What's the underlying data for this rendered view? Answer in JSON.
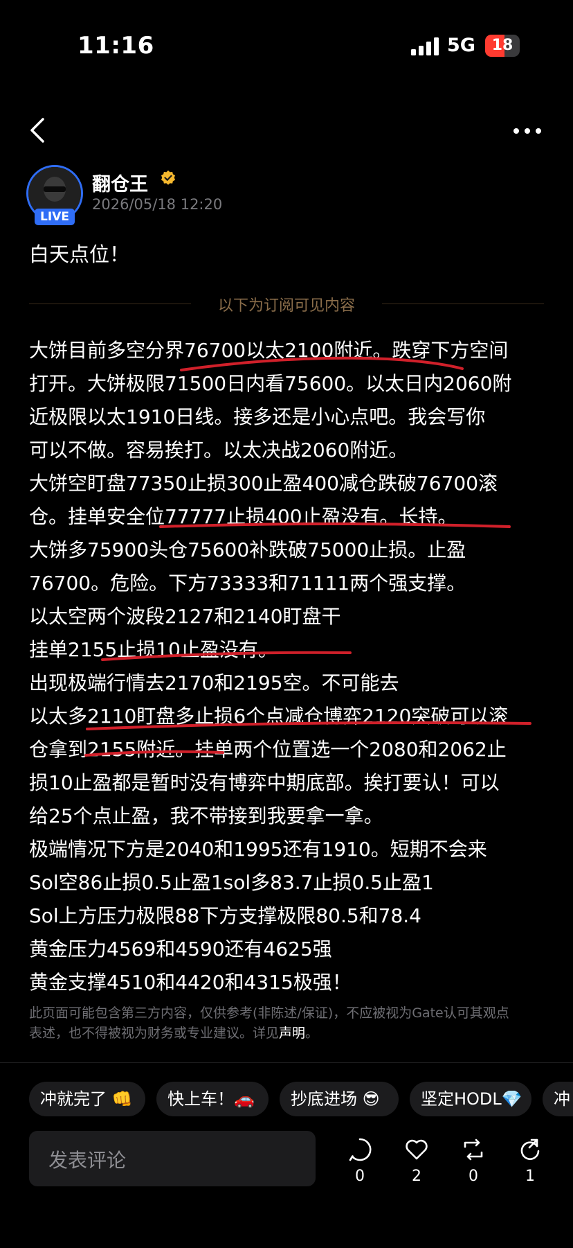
{
  "status_bar": {
    "time": "11:16",
    "network": "5G",
    "battery": "18"
  },
  "nav": {
    "back_icon": "chevron-left-icon",
    "more_icon": "more-dots-icon"
  },
  "post": {
    "author": "翻仓王",
    "live_badge": "LIVE",
    "timestamp": "2026/05/18 12:20",
    "intro": "白天点位！",
    "divider_label": "以下为订阅可见内容",
    "lines": [
      "大饼目前多空分界76700以太2100附近。跌穿下方空间",
      "打开。大饼极限71500日内看75600。以太日内2060附",
      "近极限以太1910日线。接多还是小心点吧。我会写你",
      "可以不做。容易挨打。以太决战2060附近。",
      "大饼空盯盘77350止损300止盈400减仓跌破76700滚",
      "仓。挂单安全位77777止损400止盈没有。长持。",
      "大饼多75900头仓75600补跌破75000止损。止盈",
      "76700。危险。下方73333和71111两个强支撑。",
      "以太空两个波段2127和2140盯盘干",
      "挂单2155止损10止盈没有。",
      "出现极端行情去2170和2195空。不可能去",
      "以太多2110盯盘多止损6个点减仓博弈2120突破可以滚",
      "仓拿到2155附近。挂单两个位置选一个2080和2062止",
      "损10止盈都是暂时没有博弈中期底部。挨打要认！可以",
      "给25个点止盈，我不带接到我要拿一拿。",
      "极端情况下方是2040和1995还有1910。短期不会来",
      "Sol空86止损0.5止盈1sol多83.7止损0.5止盈1",
      "Sol上方压力极限88下方支撑极限80.5和78.4",
      "黄金压力4569和4590还有4625强",
      "黄金支撑4510和4420和4315极强！"
    ],
    "disclaimer_line1": "此页面可能包含第三方内容，仅供参考(非陈述/保证)，不应被视为Gate认可其观点",
    "disclaimer_line2": "表述，也不得被视为财务或专业建议。详见",
    "disclaimer_link": "声明",
    "disclaimer_end": "。"
  },
  "quick_replies": [
    {
      "label": "冲就完了 👊"
    },
    {
      "label": "快上车！🚗"
    },
    {
      "label": "抄底进场 😎"
    },
    {
      "label": "坚定HODL💎"
    },
    {
      "label": "冲"
    }
  ],
  "comment": {
    "placeholder": "发表评论"
  },
  "actions": {
    "comments": "0",
    "likes": "2",
    "reposts": "0",
    "shares": "1"
  },
  "colors": {
    "accent_blue": "#2f6df6",
    "underline_red": "#d0202a",
    "divider_gold": "#8a6d4a",
    "verified_gold": "#f5b82e"
  }
}
